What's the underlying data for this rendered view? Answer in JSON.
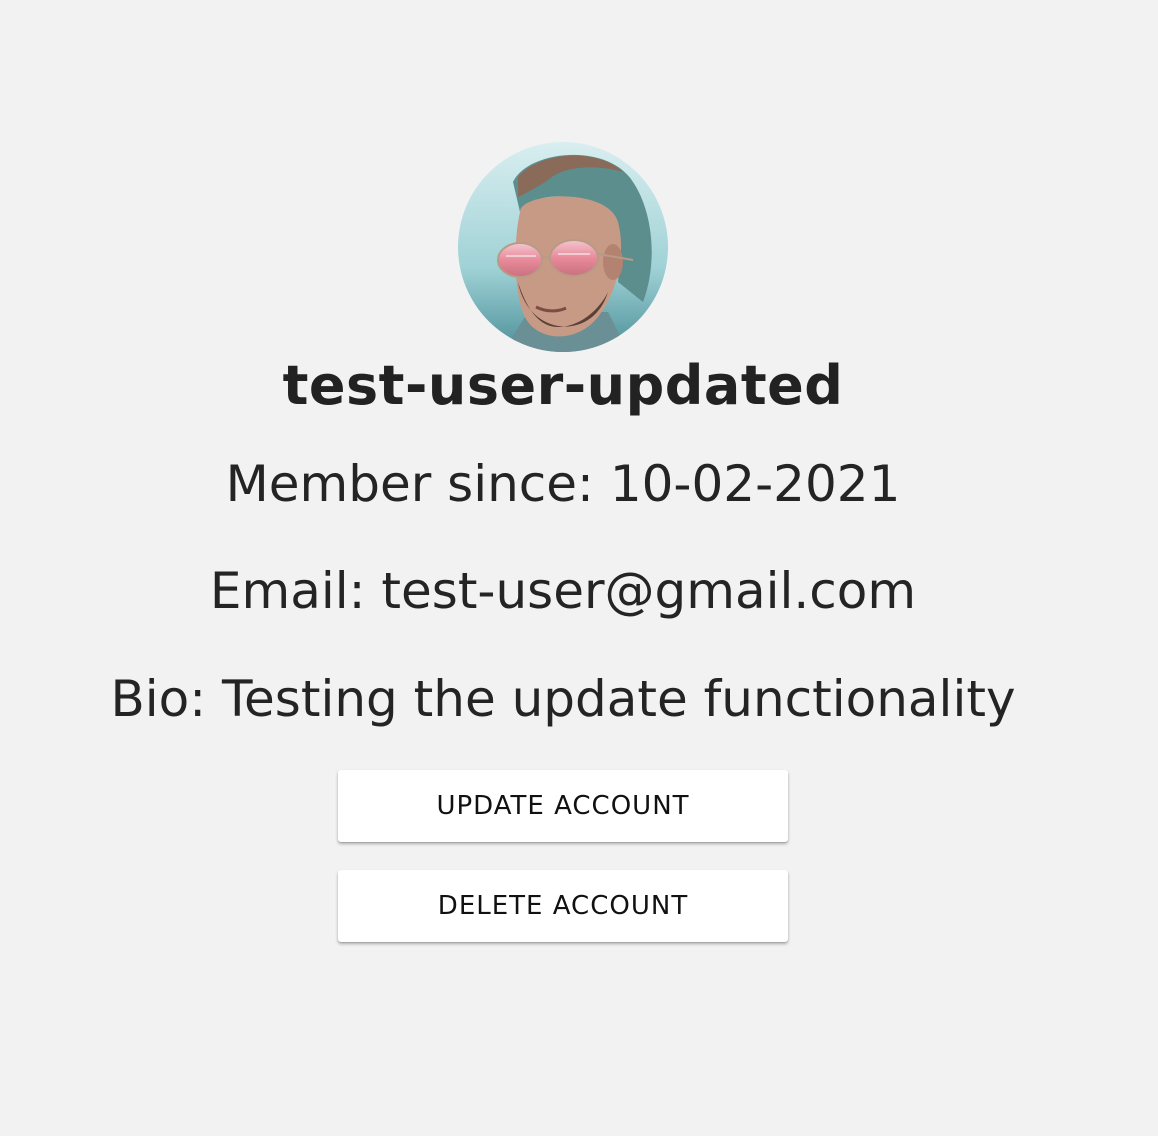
{
  "profile": {
    "avatar_alt": "profile photo",
    "username": "test-user-updated",
    "member_since_label": "Member since:",
    "member_since_value": "10-02-2021",
    "email_label": "Email:",
    "email_value": "test-user@gmail.com",
    "bio_label": "Bio:",
    "bio_value": "Testing the update functionality"
  },
  "actions": {
    "update_label": "UPDATE ACCOUNT",
    "delete_label": "DELETE ACCOUNT"
  },
  "colors": {
    "background": "#f2f2f2",
    "text": "#222222",
    "button_bg": "#ffffff"
  }
}
